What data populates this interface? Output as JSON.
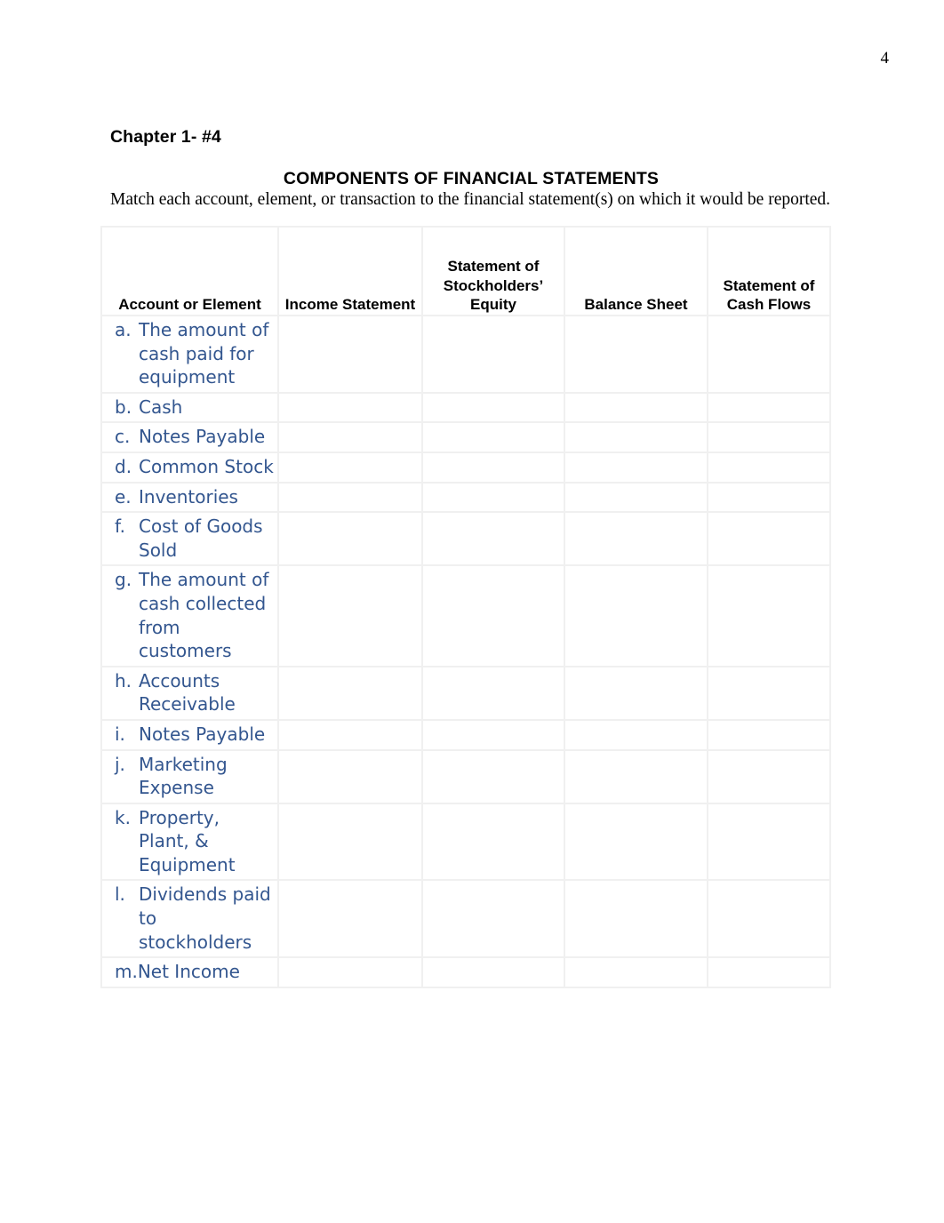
{
  "page": {
    "number": "4"
  },
  "headings": {
    "chapter": "Chapter 1- #4",
    "title": "COMPONENTS OF FINANCIAL STATEMENTS",
    "instruction": "Match each account, element, or transaction to the financial statement(s) on which it would be reported."
  },
  "colors": {
    "item_text": "#33568f",
    "heading_text": "#000000",
    "grid_line": "#f0f0f0"
  },
  "table": {
    "headers": [
      "Account or Element",
      "Income Statement",
      "Statement of Stockholders’ Equity",
      "Balance Sheet",
      "Statement of Cash Flows"
    ],
    "rows": [
      {
        "marker": "a.",
        "label": "The amount of cash paid for equipment",
        "income_statement": "",
        "statement_of_stockholders_equity": "",
        "balance_sheet": "",
        "statement_of_cash_flows": ""
      },
      {
        "marker": "b.",
        "label": "Cash",
        "income_statement": "",
        "statement_of_stockholders_equity": "",
        "balance_sheet": "",
        "statement_of_cash_flows": ""
      },
      {
        "marker": "c.",
        "label": "Notes Payable",
        "income_statement": "",
        "statement_of_stockholders_equity": "",
        "balance_sheet": "",
        "statement_of_cash_flows": ""
      },
      {
        "marker": "d.",
        "label": "Common Stock",
        "income_statement": "",
        "statement_of_stockholders_equity": "",
        "balance_sheet": "",
        "statement_of_cash_flows": ""
      },
      {
        "marker": "e.",
        "label": "Inventories",
        "income_statement": "",
        "statement_of_stockholders_equity": "",
        "balance_sheet": "",
        "statement_of_cash_flows": ""
      },
      {
        "marker": "f.",
        "label": "Cost of Goods Sold",
        "income_statement": "",
        "statement_of_stockholders_equity": "",
        "balance_sheet": "",
        "statement_of_cash_flows": ""
      },
      {
        "marker": "g.",
        "label": "The amount of cash collected from customers",
        "income_statement": "",
        "statement_of_stockholders_equity": "",
        "balance_sheet": "",
        "statement_of_cash_flows": ""
      },
      {
        "marker": "h.",
        "label": "Accounts Receivable",
        "income_statement": "",
        "statement_of_stockholders_equity": "",
        "balance_sheet": "",
        "statement_of_cash_flows": ""
      },
      {
        "marker": "i.",
        "label": "Notes Payable",
        "income_statement": "",
        "statement_of_stockholders_equity": "",
        "balance_sheet": "",
        "statement_of_cash_flows": ""
      },
      {
        "marker": "j.",
        "label": "Marketing Expense",
        "income_statement": "",
        "statement_of_stockholders_equity": "",
        "balance_sheet": "",
        "statement_of_cash_flows": ""
      },
      {
        "marker": "k.",
        "label": "Property, Plant, & Equipment",
        "income_statement": "",
        "statement_of_stockholders_equity": "",
        "balance_sheet": "",
        "statement_of_cash_flows": ""
      },
      {
        "marker": "l.",
        "label": "Dividends paid to stockholders",
        "income_statement": "",
        "statement_of_stockholders_equity": "",
        "balance_sheet": "",
        "statement_of_cash_flows": ""
      },
      {
        "marker": "m.",
        "label": "Net Income",
        "income_statement": "",
        "statement_of_stockholders_equity": "",
        "balance_sheet": "",
        "statement_of_cash_flows": ""
      }
    ]
  }
}
